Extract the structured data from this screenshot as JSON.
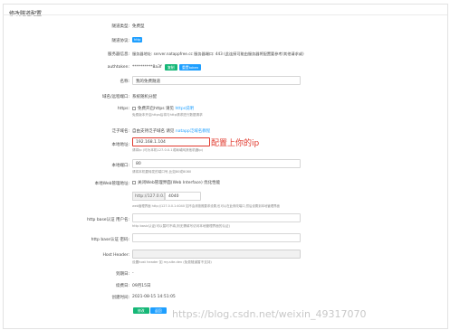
{
  "page": {
    "card_title": "修改隧道配置",
    "annotation": "配置上你的ip",
    "watermark": "https://blog.csdn.net/weixin_49317070"
  },
  "rows": {
    "tunnel_type": {
      "label": "隧道类型:",
      "value": "免费型"
    },
    "tunnel_protocol": {
      "label": "隧道协议:",
      "badge": "http"
    },
    "server_info": {
      "label": "服务器信息:",
      "value": "服务器地址: server.natappfree.cc 服务器端口: 443 (此连接可能由服务器将配置要参考/其他请求或)"
    },
    "authtoken": {
      "label": "authtoken:",
      "value": "**********8a3f",
      "copy_btn": "复制",
      "reset_btn": "重置token"
    },
    "name": {
      "label": "名称:",
      "value": "我的免费隧道"
    },
    "domain_type": {
      "label": "域名/远程端口:",
      "value": "系统随机分配"
    },
    "https": {
      "label": "https:",
      "checkbox_text": "免费开启https 请见",
      "link": "https说明",
      "hint": "免费版本开启https后将与http请求进行数据请求"
    },
    "forward": {
      "label": "泛子域名:",
      "value": "自由支持泛子域名 请见",
      "link": "natapp泛域名教程"
    },
    "local_addr": {
      "label": "本地地址:",
      "value": "192.168.1.104",
      "hint": "请将Ip (可为本机127.0.0.1或局域网其他机器ip)"
    },
    "local_port": {
      "label": "本地端口:",
      "value": "80",
      "hint": "请将本机要转发的端口号,比如80或8080"
    },
    "web_iface": {
      "label": "本地Web管理地址:",
      "checkbox_text": "关闭Web管理界面(Web Interface) 优化性能",
      "prefix": "http://127.0.0.1:",
      "value": "4040",
      "hint": "web管理界面 http://127.0.0.1:4040 如不会请按照要求设置,也可以在此修改端口,然后设置到本地管理界面"
    },
    "basic_user": {
      "label": "http base认证 用户名:",
      "value": "",
      "hint": "http basic认证(可以暂时不填,则无需填写访问本地管理界面的认证)"
    },
    "basic_pass": {
      "label": "http base认证 密码:",
      "value": ""
    },
    "host_header": {
      "label": "Host Header:",
      "value": "",
      "hint": "设置host header 如 my.site.dev (免费隧道暂不支持)"
    },
    "expire": {
      "label": "到期日:",
      "value": "-"
    },
    "renew": {
      "label": "续费日:",
      "value": "09月15日"
    },
    "created": {
      "label": "创建时间:",
      "value": "2021-08-15 14:51:05"
    }
  },
  "buttons": {
    "save": "修改",
    "back": "返回"
  },
  "colors": {
    "accent_blue": "#1e9fff",
    "accent_green": "#16b777",
    "annotation_red": "#e0392d"
  }
}
